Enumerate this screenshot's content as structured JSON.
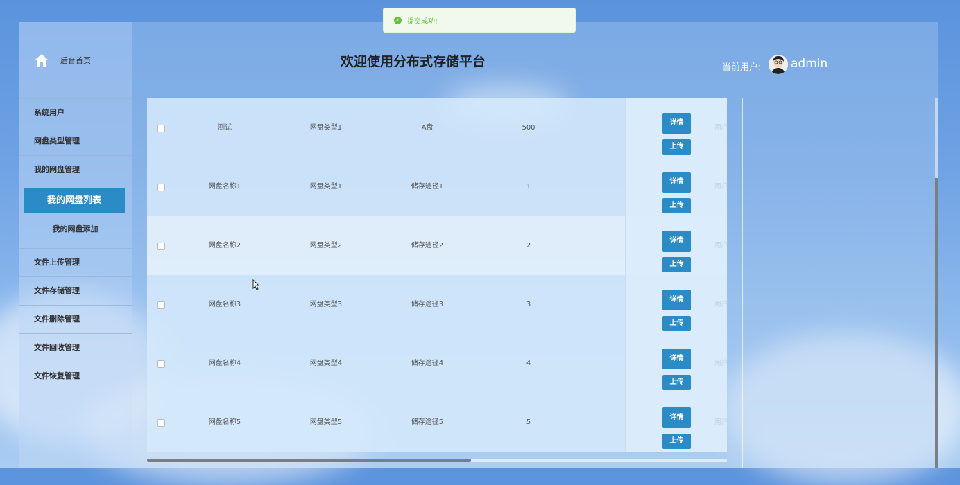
{
  "toast": {
    "message": "提交成功!",
    "icon": "success-check-icon",
    "color": "#67c23a"
  },
  "sidebar": {
    "brand": {
      "label": "后台首页",
      "icon": "home-icon"
    },
    "items": [
      {
        "label": "系统用户"
      },
      {
        "label": "网盘类型管理"
      },
      {
        "label": "我的网盘管理"
      }
    ],
    "submenu": {
      "active": "我的网盘列表",
      "sub": "我的网盘添加"
    },
    "items_after": [
      {
        "label": "文件上传管理"
      },
      {
        "label": "文件存储管理"
      },
      {
        "label": "文件删除管理"
      },
      {
        "label": "文件回收管理"
      },
      {
        "label": "文件恢复管理"
      }
    ],
    "accent": "#2a8bc6"
  },
  "header": {
    "title": "欢迎使用分布式存储平台",
    "user_label": "当前用户:",
    "username": "admin"
  },
  "table": {
    "rows": [
      {
        "name": "测试",
        "type": "网盘类型1",
        "path": "A盘",
        "size": "500",
        "detail": "详情",
        "upload": "上传",
        "extra": "用户"
      },
      {
        "name": "网盘名称1",
        "type": "网盘类型1",
        "path": "储存途径1",
        "size": "1",
        "detail": "详情",
        "upload": "上传",
        "extra": "用户"
      },
      {
        "name": "网盘名称2",
        "type": "网盘类型2",
        "path": "储存途径2",
        "size": "2",
        "detail": "详情",
        "upload": "上传",
        "extra": "用户"
      },
      {
        "name": "网盘名称3",
        "type": "网盘类型3",
        "path": "储存途径3",
        "size": "3",
        "detail": "详情",
        "upload": "上传",
        "extra": "用户"
      },
      {
        "name": "网盘名称4",
        "type": "网盘类型4",
        "path": "储存途径4",
        "size": "4",
        "detail": "详情",
        "upload": "上传",
        "extra": "用户"
      },
      {
        "name": "网盘名称5",
        "type": "网盘类型5",
        "path": "储存途径5",
        "size": "5",
        "detail": "详情",
        "upload": "上传",
        "extra": "用户"
      }
    ]
  }
}
